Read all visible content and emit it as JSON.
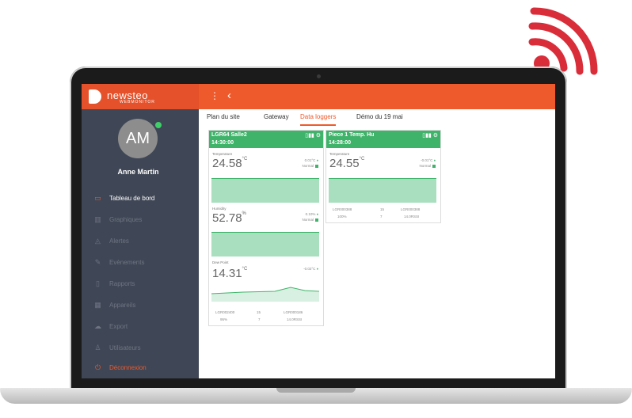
{
  "brand": {
    "name": "newsteo",
    "subtitle": "WEBMONITOR"
  },
  "header": {
    "menu_icon": "kebab-icon",
    "back_icon": "chevron-left-icon"
  },
  "user": {
    "initials": "AM",
    "name": "Anne Martin"
  },
  "sidebar": {
    "items": [
      {
        "label": "Tableau de bord",
        "icon": "monitor-icon",
        "glyph": "▭"
      },
      {
        "label": "Graphiques",
        "icon": "bar-chart-icon",
        "glyph": "▥"
      },
      {
        "label": "Alertes",
        "icon": "bell-icon",
        "glyph": "◬"
      },
      {
        "label": "Evènements",
        "icon": "pen-icon",
        "glyph": "✎"
      },
      {
        "label": "Rapports",
        "icon": "document-icon",
        "glyph": "▯"
      },
      {
        "label": "Appareils",
        "icon": "grid-icon",
        "glyph": "▦"
      },
      {
        "label": "Export",
        "icon": "cloud-icon",
        "glyph": "☁"
      },
      {
        "label": "Utilisateurs",
        "icon": "users-icon",
        "glyph": "♙"
      },
      {
        "label": "Déconnexion",
        "icon": "power-icon",
        "glyph": "⏻"
      }
    ]
  },
  "tabs": [
    {
      "label": "Plan du site"
    },
    {
      "label": "Gateway"
    },
    {
      "label": "Data loggers"
    },
    {
      "label": "Démo du 19 mai"
    }
  ],
  "cards": [
    {
      "name": "LGR64 Salle2",
      "time": "14:30:00",
      "icons": "▯▮▮ ⚙",
      "metrics": [
        {
          "label": "Temperature",
          "value": "24.58",
          "unit": "°C",
          "delta": "0.01°C",
          "status": "Normal"
        },
        {
          "label": "Humidity",
          "value": "52.78",
          "unit": "%",
          "delta": "0.10%",
          "status": "Normal"
        },
        {
          "label": "Dew Point",
          "value": "14.31",
          "unit": "°C",
          "delta": "-0.02°C",
          "status": ""
        }
      ],
      "footer": {
        "id": "LGR002400",
        "period": "15",
        "range": "LGR000186",
        "battery": "95%",
        "signal": "7",
        "state": "14.0RSSI"
      }
    },
    {
      "name": "Piece 1 Temp. Hu",
      "time": "14:28:00",
      "icons": "▯▮▮ ⚙",
      "metrics": [
        {
          "label": "Temperature",
          "value": "24.55",
          "unit": "°C",
          "delta": "-0.01°C",
          "status": "Normal"
        }
      ],
      "footer": {
        "id": "LGR000388",
        "period": "15",
        "range": "LGR000388",
        "battery": "100%",
        "signal": "7",
        "state": "14.0RSSI"
      }
    }
  ],
  "colors": {
    "accent": "#ee5a2c",
    "sidebar": "#3f4655",
    "green": "#3fb36a",
    "wifi": "#d92d3a"
  }
}
